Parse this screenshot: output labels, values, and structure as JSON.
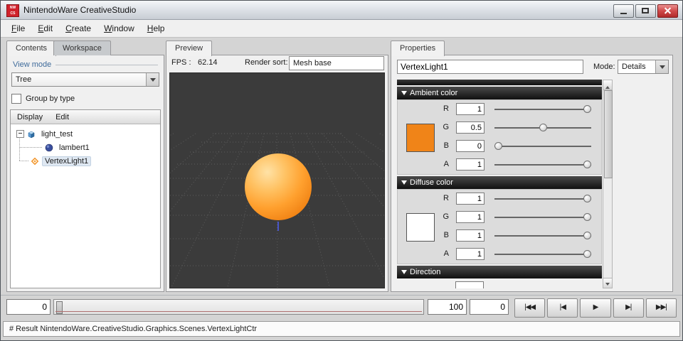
{
  "window": {
    "title": "NintendoWare CreativeStudio",
    "icon_line1": "NW",
    "icon_line2": "CS"
  },
  "menubar": {
    "items": [
      "File",
      "Edit",
      "Create",
      "Window",
      "Help"
    ]
  },
  "left_panel": {
    "tabs": {
      "contents": "Contents",
      "workspace": "Workspace"
    },
    "view_mode_label": "View mode",
    "view_mode_value": "Tree",
    "group_by_type": "Group by type",
    "tree_toolbar": {
      "display": "Display",
      "edit": "Edit"
    },
    "tree": [
      {
        "label": "light_test",
        "icon": "scene-cube-icon"
      },
      {
        "label": "lambert1",
        "icon": "material-sphere-icon"
      },
      {
        "label": "VertexLight1",
        "icon": "light-diamond-icon",
        "selected": true
      }
    ]
  },
  "preview": {
    "tab": "Preview",
    "fps_label": "FPS :",
    "fps_value": "62.14",
    "render_sort_label": "Render sort:",
    "render_sort_value": "Mesh base",
    "sphere_color": "#ff9d2e",
    "background_color": "#3b3b3b"
  },
  "properties": {
    "tab": "Properties",
    "name": "VertexLight1",
    "mode_label": "Mode:",
    "mode_value": "Details",
    "sections": [
      {
        "title": "Ambient color",
        "swatch": "#f08418",
        "channels": [
          {
            "label": "R",
            "value": "1",
            "slider": 1
          },
          {
            "label": "G",
            "value": "0.5",
            "slider": 0.5
          },
          {
            "label": "B",
            "value": "0",
            "slider": 0
          },
          {
            "label": "A",
            "value": "1",
            "slider": 1
          }
        ]
      },
      {
        "title": "Diffuse color",
        "swatch": "#ffffff",
        "channels": [
          {
            "label": "R",
            "value": "1",
            "slider": 1
          },
          {
            "label": "G",
            "value": "1",
            "slider": 1
          },
          {
            "label": "B",
            "value": "1",
            "slider": 1
          },
          {
            "label": "A",
            "value": "1",
            "slider": 1
          }
        ]
      },
      {
        "title": "Direction"
      }
    ]
  },
  "timeline": {
    "start": "0",
    "end": "100",
    "current": "0",
    "buttons": [
      {
        "name": "skip-to-start",
        "glyph": "|◀◀"
      },
      {
        "name": "step-back",
        "glyph": "|◀"
      },
      {
        "name": "play",
        "glyph": "▶"
      },
      {
        "name": "step-forward",
        "glyph": "▶|"
      },
      {
        "name": "skip-to-end",
        "glyph": "▶▶|"
      }
    ]
  },
  "statusbar": {
    "text": "# Result NintendoWare.CreativeStudio.Graphics.Scenes.VertexLightCtr"
  }
}
